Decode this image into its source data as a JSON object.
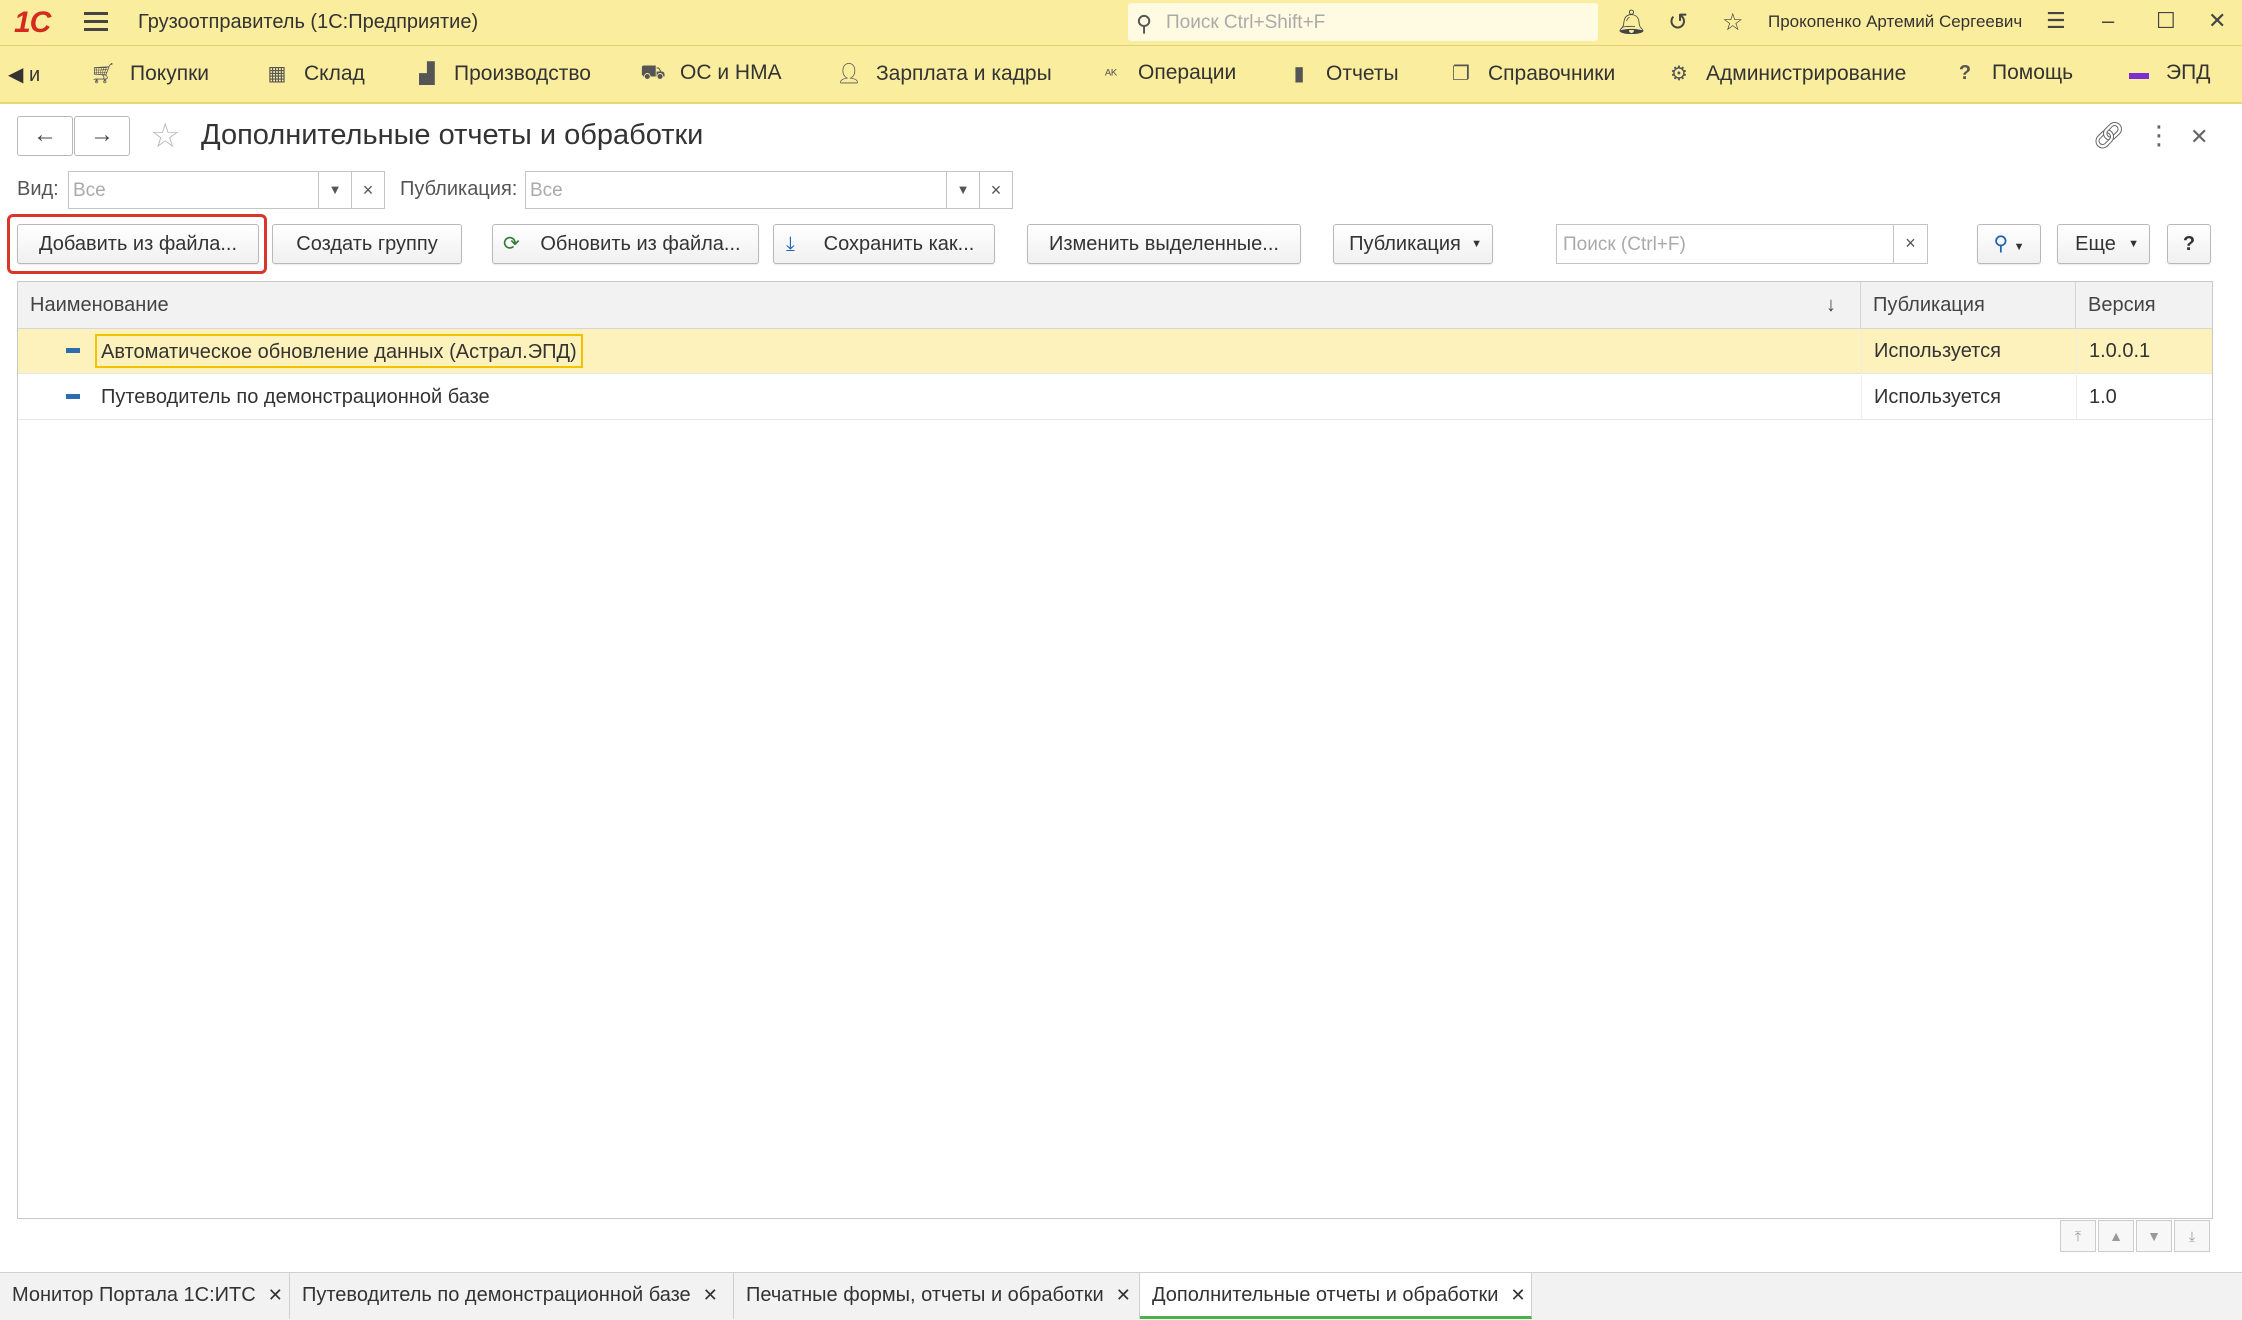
{
  "app": {
    "logo": "1С",
    "title": "Грузоотправитель  (1С:Предприятие)",
    "search_placeholder": "Поиск Ctrl+Shift+F",
    "user": "Прокопенко Артемий Сергеевич"
  },
  "sections": {
    "left_partial": "и",
    "items": [
      {
        "label": "Покупки",
        "icon": "cart-icon"
      },
      {
        "label": "Склад",
        "icon": "warehouse-icon"
      },
      {
        "label": "Производство",
        "icon": "factory-icon"
      },
      {
        "label": "ОС и НМА",
        "icon": "truck-icon"
      },
      {
        "label": "Зарплата и кадры",
        "icon": "person-icon"
      },
      {
        "label": "Операции",
        "icon": "operations-icon"
      },
      {
        "label": "Отчеты",
        "icon": "bar-chart-icon"
      },
      {
        "label": "Справочники",
        "icon": "book-icon"
      },
      {
        "label": "Администрирование",
        "icon": "gear-icon"
      },
      {
        "label": "Помощь",
        "icon": "help-icon"
      },
      {
        "label": "ЭПД",
        "icon": "epd-icon"
      }
    ]
  },
  "form": {
    "title": "Дополнительные отчеты и обработки"
  },
  "filters": {
    "kind_label": "Вид:",
    "kind_value": "Все",
    "publication_label": "Публикация:",
    "publication_value": "Все"
  },
  "toolbar": {
    "add_from_file": "Добавить из файла...",
    "create_group": "Создать группу",
    "update_from_file": "Обновить из файла...",
    "save_as": "Сохранить как...",
    "change_selected": "Изменить выделенные...",
    "publication": "Публикация",
    "search_placeholder": "Поиск (Ctrl+F)",
    "more": "Еще",
    "help": "?"
  },
  "table": {
    "columns": [
      "Наименование",
      "Публикация",
      "Версия"
    ],
    "sort_indicator": "↓",
    "rows": [
      {
        "name": "Автоматическое обновление данных (Астрал.ЭПД)",
        "publication": "Используется",
        "version": "1.0.0.1"
      },
      {
        "name": "Путеводитель по демонстрационной базе",
        "publication": "Используется",
        "version": "1.0"
      }
    ]
  },
  "tabs": [
    {
      "label": "Монитор Портала 1С:ИТС"
    },
    {
      "label": "Путеводитель по демонстрационной базе"
    },
    {
      "label": "Печатные формы, отчеты и обработки"
    },
    {
      "label": "Дополнительные отчеты и обработки",
      "active": true
    }
  ],
  "colors": {
    "top_bar": "#fbed9e",
    "highlight_frame": "#d9372b",
    "selected_row": "#fdf1bc",
    "active_tab_underline": "#4caf50"
  }
}
